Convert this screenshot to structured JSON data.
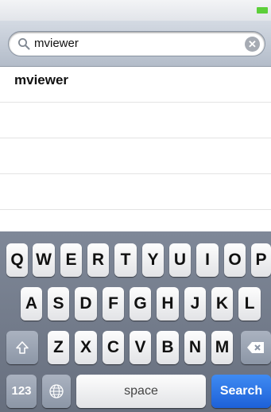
{
  "search": {
    "query": "mviewer"
  },
  "results": [
    {
      "label": "mviewer"
    },
    {
      "label": ""
    },
    {
      "label": ""
    },
    {
      "label": ""
    },
    {
      "label": ""
    }
  ],
  "keyboard": {
    "row1": [
      "Q",
      "W",
      "E",
      "R",
      "T",
      "Y",
      "U",
      "I",
      "O",
      "P"
    ],
    "row2": [
      "A",
      "S",
      "D",
      "F",
      "G",
      "H",
      "J",
      "K",
      "L"
    ],
    "row3": [
      "Z",
      "X",
      "C",
      "V",
      "B",
      "N",
      "M"
    ],
    "numbers_label": "123",
    "space_label": "space",
    "search_label": "Search"
  },
  "icons": {
    "battery": "battery-icon",
    "search": "search-icon",
    "clear": "clear-icon",
    "shift": "shift-icon",
    "delete": "backspace-icon",
    "globe": "globe-icon"
  },
  "colors": {
    "search_key": "#1d61d8",
    "battery": "#5ccf3a"
  }
}
